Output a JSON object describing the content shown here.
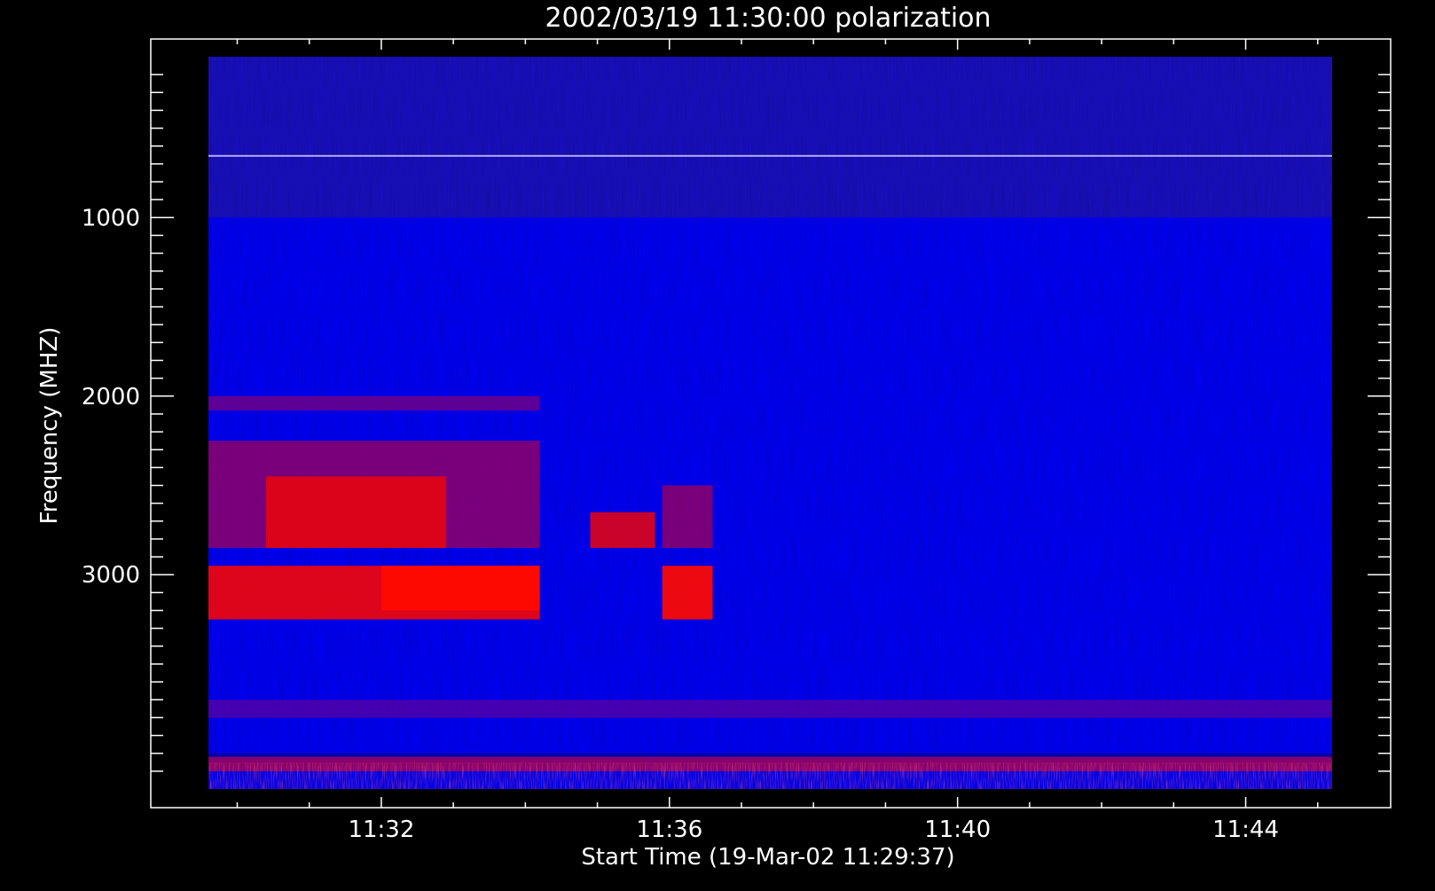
{
  "chart_data": {
    "type": "heatmap",
    "title": "2002/03/19 11:30:00 polarization",
    "xlabel": "Start Time (19-Mar-02 11:29:37)",
    "ylabel": "Frequency (MHZ)",
    "x_ticks": [
      "11:32",
      "11:36",
      "11:40",
      "11:44"
    ],
    "y_ticks": [
      "1000",
      "2000",
      "3000"
    ],
    "x_range_minutes": [
      29.6,
      45.2
    ],
    "y_range_mhz": [
      100,
      4200
    ],
    "y_inverted": true,
    "grid": false,
    "colormap": {
      "low": "#000000",
      "mid": "#0000ff",
      "high": "#ff2000",
      "peak": "#ffffff"
    },
    "regions": [
      {
        "t": [
          29.6,
          34.2
        ],
        "f": [
          2250,
          2850
        ],
        "level": 0.55
      },
      {
        "t": [
          30.4,
          32.9
        ],
        "f": [
          2450,
          2850
        ],
        "level": 0.8
      },
      {
        "t": [
          29.6,
          34.2
        ],
        "f": [
          2950,
          3250
        ],
        "level": 0.85
      },
      {
        "t": [
          32.0,
          34.2
        ],
        "f": [
          2950,
          3200
        ],
        "level": 0.95
      },
      {
        "t": [
          34.9,
          35.8
        ],
        "f": [
          2650,
          2850
        ],
        "level": 0.8
      },
      {
        "t": [
          35.9,
          36.6
        ],
        "f": [
          2950,
          3250
        ],
        "level": 0.95
      },
      {
        "t": [
          35.9,
          36.6
        ],
        "f": [
          2500,
          2850
        ],
        "level": 0.55
      },
      {
        "t": [
          29.6,
          34.2
        ],
        "f": [
          2000,
          2080
        ],
        "level": 0.45
      },
      {
        "t": [
          29.6,
          45.2
        ],
        "f": [
          3700,
          3800
        ],
        "level": 0.35
      },
      {
        "t": [
          29.6,
          45.2
        ],
        "f": [
          4000,
          4100
        ],
        "level": 0.6
      }
    ]
  }
}
